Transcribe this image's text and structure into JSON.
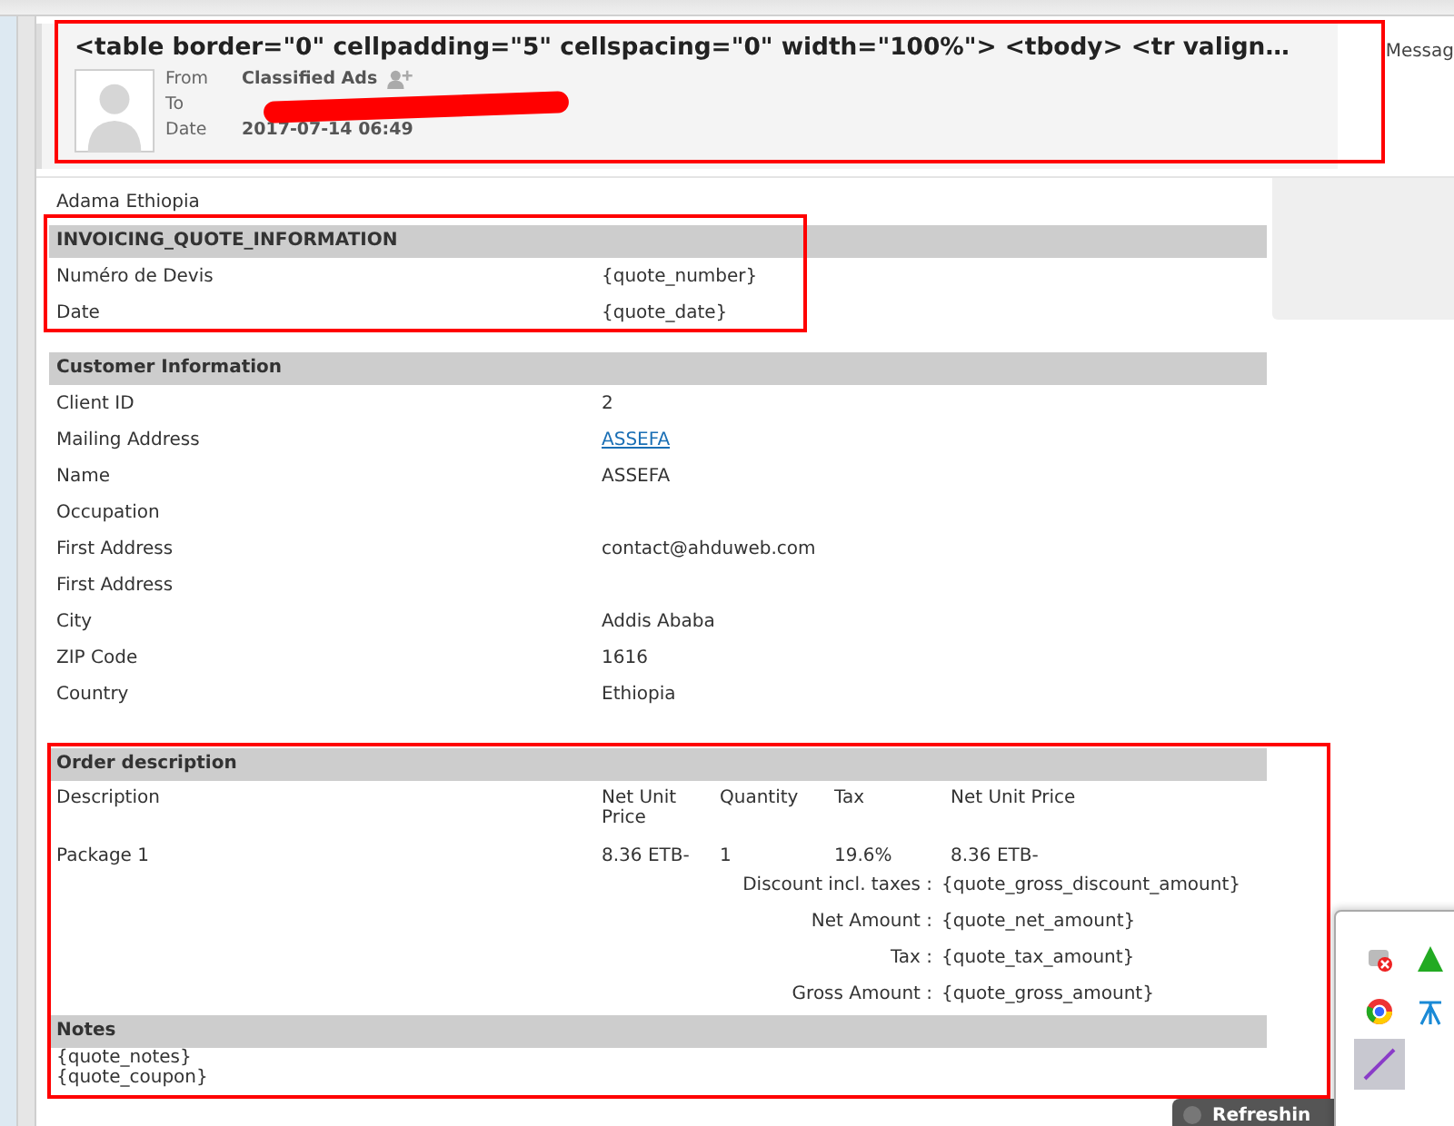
{
  "message": {
    "subject": "<table border=\"0\" cellpadding=\"5\" cellspacing=\"0\" width=\"100%\"> <tbody> <tr valign…",
    "from_label": "From",
    "from": "Classified Ads",
    "to_label": "To",
    "date_label": "Date",
    "date": "2017-07-14 06:49"
  },
  "side_label": "Messag",
  "location": "Adama Ethiopia",
  "sections": [
    {
      "kind": "fields",
      "title": "INVOICING_QUOTE_INFORMATION",
      "rows": [
        {
          "label": "Numéro de Devis",
          "value": "{quote_number}"
        },
        {
          "label": "Date",
          "value": "{quote_date}"
        }
      ]
    },
    {
      "kind": "fields",
      "title": "Customer Information",
      "rows": [
        {
          "label": "Client ID",
          "value": "2"
        },
        {
          "label": "Mailing Address",
          "value": "ASSEFA",
          "link": true
        },
        {
          "label": "Name",
          "value": "ASSEFA"
        },
        {
          "label": "Occupation"
        },
        {
          "label": "First Address",
          "value": "contact@ahduweb.com"
        },
        {
          "label": "First Address"
        },
        {
          "label": "City",
          "value": "Addis Ababa"
        },
        {
          "label": "ZIP Code",
          "value": "1616"
        },
        {
          "label": "Country",
          "value": "Ethiopia"
        }
      ]
    },
    {
      "kind": "order",
      "title": "Order description",
      "columns": [
        "Description",
        "Net Unit Price",
        "Quantity",
        "Tax",
        "Net Unit Price"
      ],
      "items": [
        [
          "Package 1",
          "8.36 ETB-",
          "1",
          "19.6%",
          "8.36 ETB-"
        ]
      ],
      "totals": [
        {
          "label": "Discount incl. taxes :",
          "value": "{quote_gross_discount_amount}"
        },
        {
          "label": "Net Amount :",
          "value": "{quote_net_amount}"
        },
        {
          "label": "Tax :",
          "value": "{quote_tax_amount}"
        },
        {
          "label": "Gross Amount :",
          "value": "{quote_gross_amount}"
        }
      ]
    },
    {
      "kind": "notes",
      "title": "Notes",
      "lines": [
        "{quote_notes}",
        "{quote_coupon}"
      ]
    }
  ],
  "toast": {
    "text": "Refreshin"
  }
}
